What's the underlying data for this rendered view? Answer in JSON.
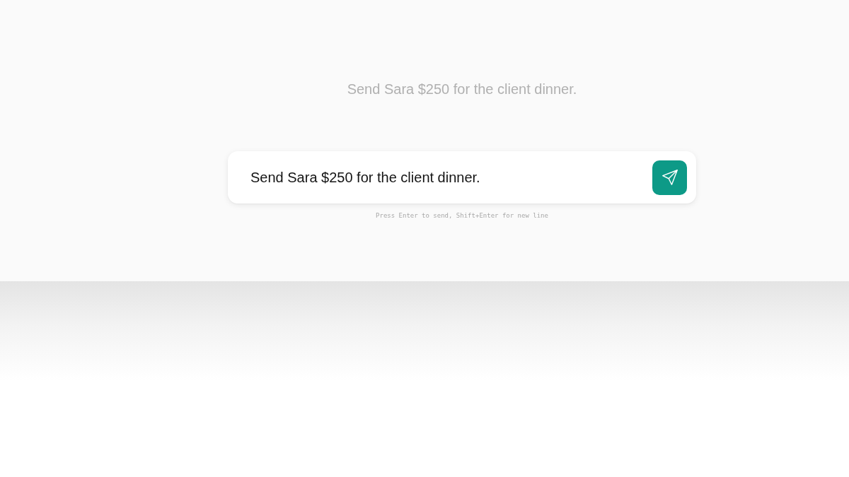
{
  "echo_text": "Send Sara $250 for the client dinner.",
  "composer": {
    "value": "Send Sara $250 for the client dinner."
  },
  "hint": "Press Enter to send, Shift+Enter for new line"
}
